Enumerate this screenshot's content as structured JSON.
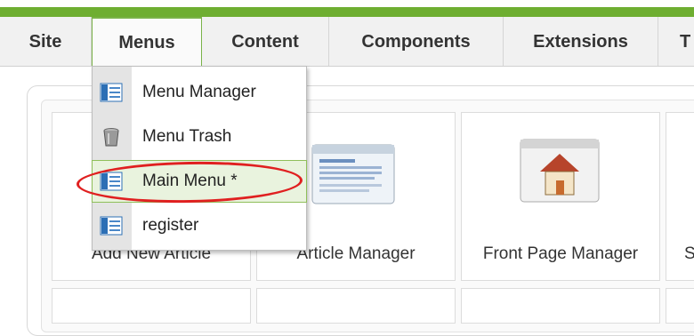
{
  "menubar": {
    "items": [
      {
        "label": "Site"
      },
      {
        "label": "Menus"
      },
      {
        "label": "Content"
      },
      {
        "label": "Components"
      },
      {
        "label": "Extensions"
      },
      {
        "label": "T"
      }
    ],
    "active_index": 1,
    "accent_color": "#6eae31"
  },
  "dropdown": {
    "items": [
      {
        "label": "Menu Manager",
        "icon": "menu-icon"
      },
      {
        "label": "Menu Trash",
        "icon": "trash-icon"
      },
      {
        "label": "Main Menu *",
        "icon": "menu-icon",
        "highlighted": true
      },
      {
        "label": "register",
        "icon": "menu-icon"
      }
    ],
    "annotation_color": "#e02020"
  },
  "dashboard": {
    "cells": [
      {
        "label": "Add New Article",
        "icon": ""
      },
      {
        "label": "Article Manager",
        "icon": "article-manager-icon"
      },
      {
        "label": "Front Page Manager",
        "icon": "front-page-icon"
      },
      {
        "label": "S",
        "icon": ""
      }
    ]
  }
}
